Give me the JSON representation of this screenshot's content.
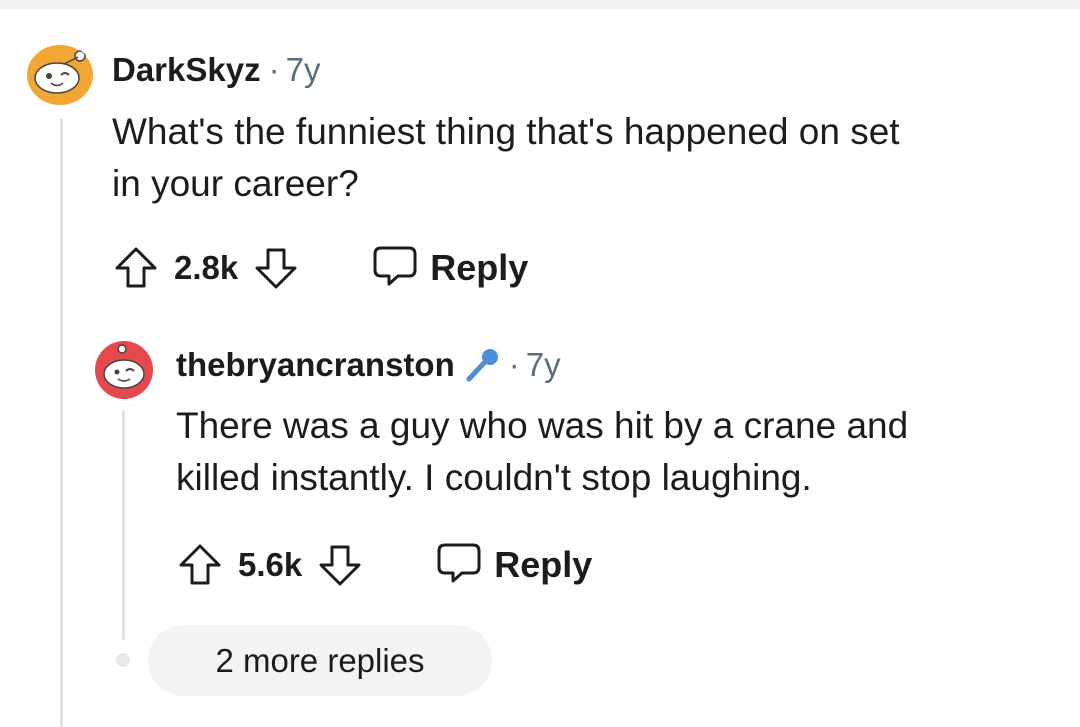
{
  "comments": [
    {
      "username": "DarkSkyz",
      "age": "7y",
      "body_lines": [
        "What's the funniest thing that's happened on set",
        "in your career?"
      ],
      "score": "2.8k",
      "reply_label": "Reply",
      "avatar_color": "#f2a633"
    },
    {
      "username": "thebryancranston",
      "flair_icon": "microphone-icon",
      "age": "7y",
      "body_lines": [
        "There was a guy who was hit by a crane and",
        "killed instantly. I couldn't stop laughing."
      ],
      "score": "5.6k",
      "reply_label": "Reply",
      "avatar_color": "#e5484d"
    }
  ],
  "more_replies_label": "2 more replies",
  "separator": "·",
  "colors": {
    "accent_blue": "#4a90d9",
    "text": "#1c1c1c",
    "meta": "#576f76"
  }
}
